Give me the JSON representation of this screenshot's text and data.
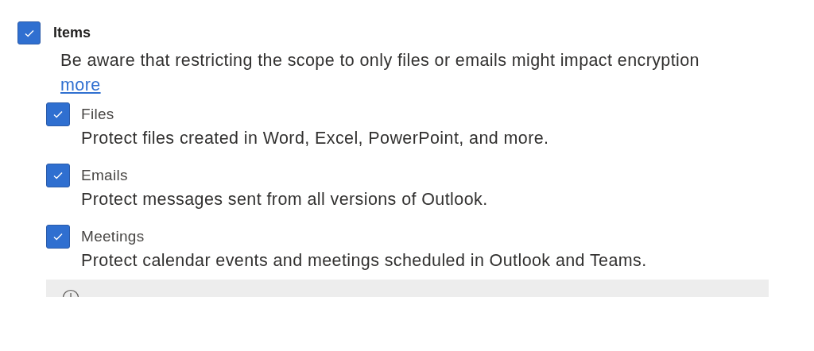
{
  "group": {
    "label": "Items",
    "checked": true,
    "description": "Be aware that restricting the scope to only files or emails might impact encryption",
    "link": "more"
  },
  "options": [
    {
      "label": "Files",
      "checked": true,
      "description": "Protect files created in Word, Excel, PowerPoint, and more."
    },
    {
      "label": "Emails",
      "checked": true,
      "description": "Protect messages sent from all versions of Outlook."
    },
    {
      "label": "Meetings",
      "checked": true,
      "description": "Protect calendar events and meetings scheduled in Outlook and Teams."
    }
  ]
}
